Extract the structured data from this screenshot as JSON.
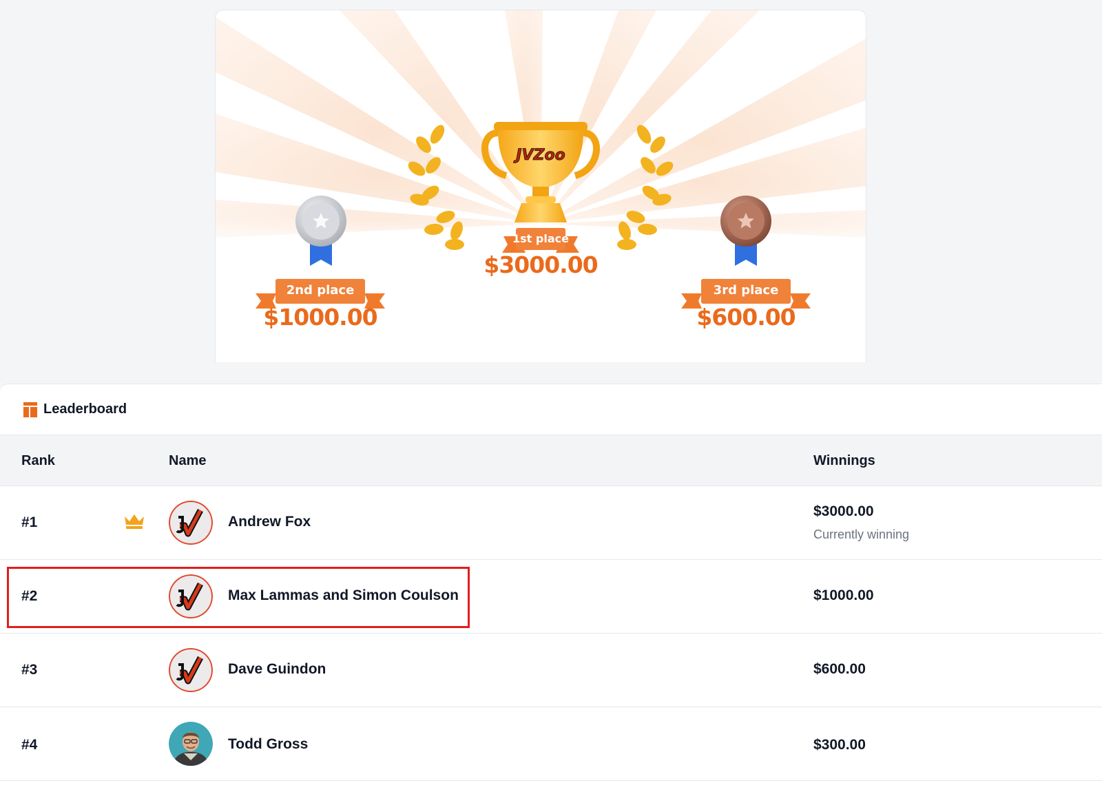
{
  "prizes": {
    "first": {
      "label": "1st place",
      "amount": "$3000.00",
      "logo_text": "JVZoo"
    },
    "second": {
      "label": "2nd place",
      "amount": "$1000.00"
    },
    "third": {
      "label": "3rd place",
      "amount": "$600.00"
    }
  },
  "leaderboard": {
    "title": "Leaderboard",
    "icon": "leaderboard-icon",
    "columns": {
      "rank": "Rank",
      "name": "Name",
      "winnings": "Winnings"
    },
    "rows": [
      {
        "rank": "#1",
        "name": "Andrew Fox",
        "winnings": "$3000.00",
        "status": "Currently winning",
        "leader_icon": "crown-icon",
        "avatar": "jvzoo-logo-avatar"
      },
      {
        "rank": "#2",
        "name": "Max Lammas and Simon Coulson",
        "winnings": "$1000.00",
        "avatar": "jvzoo-logo-avatar",
        "highlighted": true
      },
      {
        "rank": "#3",
        "name": "Dave Guindon",
        "winnings": "$600.00",
        "avatar": "jvzoo-logo-avatar"
      },
      {
        "rank": "#4",
        "name": "Todd Gross",
        "winnings": "$300.00",
        "avatar": "user-photo-avatar"
      }
    ]
  },
  "colors": {
    "accent": "#ea6a1c",
    "gold": "#f3b21f",
    "silver": "#c9ccd1",
    "bronze": "#a0614b",
    "ribbon_blue": "#2f6fe0",
    "highlight": "#e11d1d"
  }
}
